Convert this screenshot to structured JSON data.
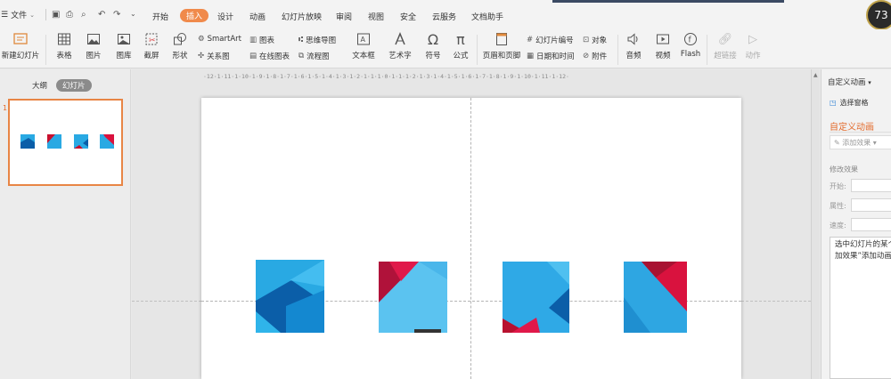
{
  "menu": {
    "file_label": "文件",
    "tabs": [
      "开始",
      "插入",
      "设计",
      "动画",
      "幻灯片放映",
      "审阅",
      "视图",
      "安全",
      "云服务",
      "文档助手"
    ],
    "active_tab": "插入"
  },
  "badge": "73",
  "ribbon": {
    "new_slide": "新建幻灯片",
    "table": "表格",
    "picture": "图片",
    "gallery": "图库",
    "screenshot": "截屏",
    "shape": "形状",
    "smartart": "SmartArt",
    "chart": "图表",
    "relation": "关系图",
    "online_chart": "在线图表",
    "mindmap": "思维导图",
    "flowchart": "流程图",
    "textbox": "文本框",
    "wordart": "艺术字",
    "symbol": "符号",
    "formula": "公式",
    "header_footer": "页眉和页脚",
    "slide_number": "幻灯片编号",
    "datetime": "日期和时间",
    "object": "对象",
    "attachment": "附件",
    "audio": "音频",
    "video": "视频",
    "flash": "Flash",
    "hyperlink": "超链接",
    "action": "动作"
  },
  "left_panel": {
    "tab_outline": "大纲",
    "tab_slides": "幻灯片",
    "slide_number": "1"
  },
  "ruler_text": "·12·1·11·1·10·1·9·1·8·1·7·1·6·1·5·1·4·1·3·1·2·1·1·1·0·1·1·1·2·1·3·1·4·1·5·1·6·1·7·1·8·1·9·1·10·1·11·1·12·",
  "right_panel": {
    "title": "自定义动画",
    "select_pane": "选择窗格",
    "heading": "自定义动画",
    "add_effect": "添加效果",
    "modify_effect": "修改效果",
    "start": "开始:",
    "property": "属性:",
    "speed": "速度:",
    "hint_line1": "选中幻灯片的某个",
    "hint_line2": "加效果”添加动画"
  },
  "colors": {
    "accent": "#f08a4b",
    "blue": "#29a9e3",
    "dark_blue": "#0b5ea8",
    "red": "#d9123e"
  }
}
